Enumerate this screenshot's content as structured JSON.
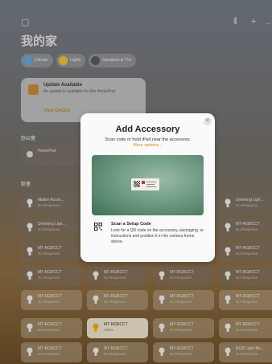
{
  "header": {
    "title": "我的家",
    "left_icon": "sidebar-icon",
    "right_icons": [
      "waveform-icon",
      "plus-icon",
      "ellipsis-icon"
    ]
  },
  "chips": [
    {
      "label": "Climate",
      "sub": "",
      "color": "#5aa9e6",
      "icon": "thermometer-icon"
    },
    {
      "label": "Lights",
      "sub": "",
      "color": "#f2c230",
      "icon": "lightbulb-icon"
    },
    {
      "label": "Speakers & TVs",
      "sub": "",
      "color": "#555555",
      "icon": "tv-icon"
    }
  ],
  "update": {
    "title": "Update Available",
    "desc": "An update is available for this HomePod.",
    "link": "View Details"
  },
  "sections": {
    "office": "办公室",
    "default_room": "卧室"
  },
  "homepod_tile": {
    "name": "HomePod",
    "status": ""
  },
  "tiles": [
    {
      "name": "Matter Acces...",
      "status": "No Response",
      "col": 0,
      "row": 0,
      "style": "normal"
    },
    {
      "name": "Dimming Ligh...",
      "status": "No Response",
      "col": 3,
      "row": 0,
      "style": "normal"
    },
    {
      "name": "Dimming Ligh...",
      "status": "No Response",
      "col": 0,
      "row": 1,
      "style": "normal"
    },
    {
      "name": "MT-RGBCCT",
      "status": "No Response",
      "col": 3,
      "row": 1,
      "style": "normal"
    },
    {
      "name": "MT-RGBCCT",
      "status": "No Response",
      "col": 0,
      "row": 2,
      "style": "normal"
    },
    {
      "name": "MT-RGBCCT",
      "status": "No Response",
      "col": 3,
      "row": 2,
      "style": "normal"
    },
    {
      "name": "MT-RGBCCT",
      "status": "No Response",
      "col": 0,
      "row": 3,
      "style": "normal"
    },
    {
      "name": "MT-RGBCCT",
      "status": "No Response",
      "col": 1,
      "row": 3,
      "style": "normal"
    },
    {
      "name": "MT-RGBCCT",
      "status": "No Response",
      "col": 2,
      "row": 3,
      "style": "normal"
    },
    {
      "name": "MT-RGBCCT",
      "status": "No Response",
      "col": 3,
      "row": 3,
      "style": "normal"
    },
    {
      "name": "MT-RGBCCT",
      "status": "No Response",
      "col": 0,
      "row": 4,
      "style": "bright"
    },
    {
      "name": "MT-RGBCCT",
      "status": "No Response",
      "col": 1,
      "row": 4,
      "style": "bright"
    },
    {
      "name": "MT-RGBCCT",
      "status": "No Response",
      "col": 2,
      "row": 4,
      "style": "bright"
    },
    {
      "name": "MT-RGBCCT",
      "status": "No Response",
      "col": 3,
      "row": 4,
      "style": "bright"
    },
    {
      "name": "MT-RGBCCT",
      "status": "No Response",
      "col": 0,
      "row": 5,
      "style": "bright"
    },
    {
      "name": "MT-RGBCCT",
      "status": "100%",
      "col": 1,
      "row": 5,
      "style": "lit"
    },
    {
      "name": "MT-RGBCCT",
      "status": "No Response",
      "col": 2,
      "row": 5,
      "style": "bright"
    },
    {
      "name": "MT-RGBCCT",
      "status": "No Response",
      "col": 3,
      "row": 5,
      "style": "bright"
    },
    {
      "name": "MT-RGBCCT",
      "status": "No Response",
      "col": 0,
      "row": 6,
      "style": "bright"
    },
    {
      "name": "MT-RGBCCT",
      "status": "No Response",
      "col": 1,
      "row": 6,
      "style": "bright"
    },
    {
      "name": "MT-RGBCCT",
      "status": "No Response",
      "col": 2,
      "row": 6,
      "style": "bright"
    },
    {
      "name": "RGB Light Be...",
      "status": "No Response",
      "col": 3,
      "row": 6,
      "style": "bright"
    }
  ],
  "modal": {
    "title": "Add Accessory",
    "subtitle": "Scan code or hold iPad near the accessory.",
    "more_options": "More options...",
    "close_icon": "close-icon",
    "scan_title": "Scan a Setup Code",
    "scan_desc": "Look for a QR code on the accessory, packaging, or instructions and position it in the camera frame above.",
    "scan_icon": "qr-code-icon"
  },
  "colors": {
    "accent": "#d48a14",
    "bulb_off": "#f1f1f1",
    "bulb_on": "#f2b100"
  }
}
